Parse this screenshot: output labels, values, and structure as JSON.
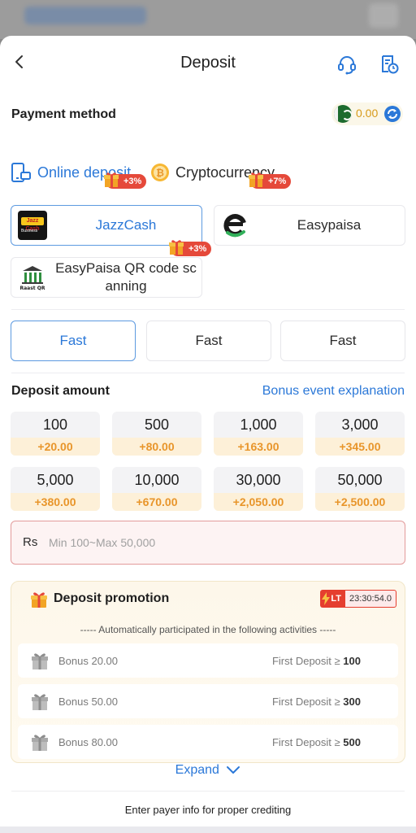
{
  "header": {
    "title": "Deposit",
    "back_icon": "chevron-left-icon",
    "support_icon": "headset-icon",
    "history_icon": "document-clock-icon"
  },
  "payment_method": {
    "label": "Payment method",
    "balance": "0.00",
    "flag_icon": "pakistan-flag-icon",
    "refresh_icon": "refresh-icon"
  },
  "tabs": [
    {
      "label": "Online deposit",
      "badge": "+3%",
      "icon": "phone-card-icon",
      "selected": true
    },
    {
      "label": "Cryptocurrency",
      "badge": "+7%",
      "icon": "bitcoin-icon",
      "selected": false
    }
  ],
  "channels": [
    {
      "name": "JazzCash",
      "logo_text": "Jazz Cash",
      "logo_sub": "Business",
      "selected": true
    },
    {
      "name": "Easypaisa",
      "selected": false
    },
    {
      "name": "EasyPaisa QR code sc anning",
      "name_line1": "EasyPaisa QR code sc",
      "name_line2": "anning",
      "badge": "+3%",
      "logo_text": "Raast QR",
      "selected": false
    }
  ],
  "speed_options": [
    {
      "label": "Fast",
      "selected": true
    },
    {
      "label": "Fast",
      "selected": false
    },
    {
      "label": "Fast",
      "selected": false
    }
  ],
  "deposit_amount": {
    "label": "Deposit amount",
    "bonus_link": "Bonus event explanation",
    "options": [
      {
        "value": "100",
        "bonus": "+20.00"
      },
      {
        "value": "500",
        "bonus": "+80.00"
      },
      {
        "value": "1,000",
        "bonus": "+163.00"
      },
      {
        "value": "3,000",
        "bonus": "+345.00"
      },
      {
        "value": "5,000",
        "bonus": "+380.00"
      },
      {
        "value": "10,000",
        "bonus": "+670.00"
      },
      {
        "value": "30,000",
        "bonus": "+2,050.00"
      },
      {
        "value": "50,000",
        "bonus": "+2,500.00"
      }
    ],
    "currency": "Rs",
    "placeholder": "Min 100~Max 50,000"
  },
  "promotion": {
    "title": "Deposit promotion",
    "lt_label": "LT",
    "timer": "23:30:54.0",
    "subtitle": "----- Automatically participated in the following activities -----",
    "rows": [
      {
        "bonus": "Bonus 20.00",
        "condition": "First Deposit ≥",
        "amount": "100"
      },
      {
        "bonus": "Bonus 50.00",
        "condition": "First Deposit ≥",
        "amount": "300"
      },
      {
        "bonus": "Bonus 80.00",
        "condition": "First Deposit ≥",
        "amount": "500"
      }
    ],
    "expand_label": "Expand"
  },
  "footer_note": "Enter payer info for proper crediting",
  "colors": {
    "accent": "#2b78d8",
    "bonus": "#e8952a",
    "badge": "#e5493a",
    "input_border": "#e39b9b"
  }
}
